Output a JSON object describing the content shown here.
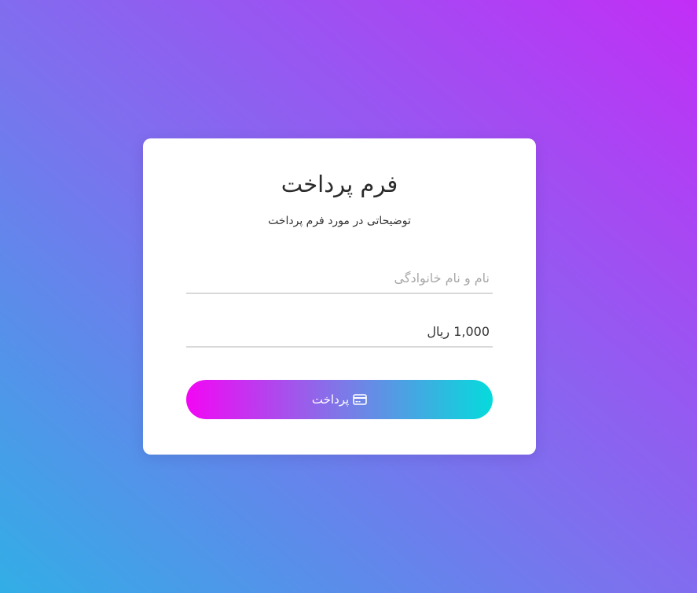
{
  "form": {
    "title": "فرم پرداخت",
    "subtitle": "توضیحاتی در مورد فرم پرداخت",
    "name_field": {
      "placeholder": "نام و نام خانوادگی",
      "value": ""
    },
    "amount_field": {
      "value": "1,000 ریال"
    },
    "pay_button": {
      "label": "پرداخت",
      "icon": "credit-card-icon"
    }
  },
  "colors": {
    "background_gradient": [
      "#32aee6",
      "#7b72ee",
      "#c22ef6"
    ],
    "button_gradient": [
      "#f306f4",
      "#7f77e8",
      "#05dbdc"
    ],
    "card": "#ffffff"
  }
}
